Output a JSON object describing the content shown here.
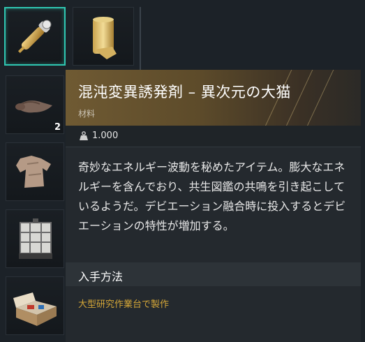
{
  "inventory": {
    "slots": [
      {
        "name": "chaos-mutagen-vial",
        "icon": "golden-syringe-icon",
        "selected": true
      },
      {
        "name": "golden-fabric-roll",
        "icon": "fabric-roll-icon"
      },
      {
        "name": "leather-scraps",
        "icon": "leather-icon",
        "count": "2"
      },
      {
        "name": "cloth-rag",
        "icon": "cloth-icon"
      },
      {
        "name": "ibc-tank",
        "icon": "tank-icon"
      },
      {
        "name": "supply-crate",
        "icon": "crate-icon"
      }
    ]
  },
  "tooltip": {
    "title": "混沌変異誘発剤 – 異次元の大猫",
    "category": "材料",
    "weight_icon": "weight-icon",
    "weight": "1.000",
    "description": "奇妙なエネルギー波動を秘めたアイテム。膨大なエネルギーを含んでおり、共生図鑑の共鳴を引き起こしているようだ。デビエーション融合時に投入するとデビエーションの特性が増加する。",
    "acquire_heading": "入手方法",
    "acquire_source": "大型研究作業台で製作"
  },
  "colors": {
    "selection": "#2fc7b2",
    "header_gold": "#6f5a33",
    "source_text": "#d4a638"
  }
}
